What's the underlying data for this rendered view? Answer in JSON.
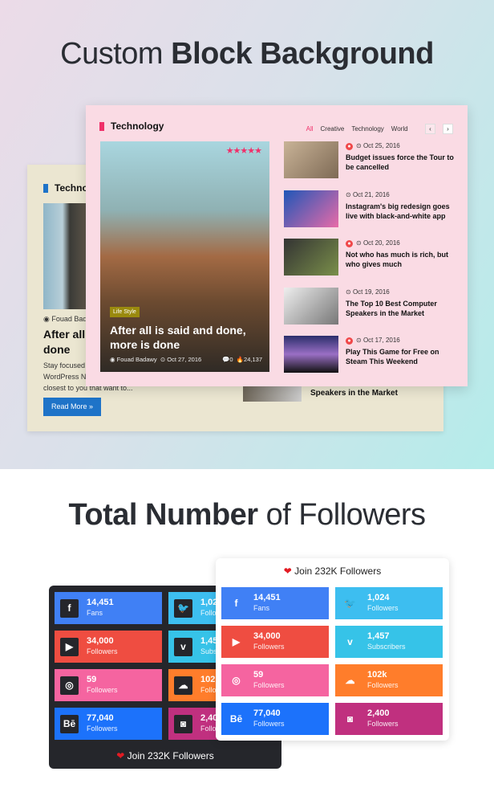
{
  "section1": {
    "title_light": "Custom ",
    "title_bold": "Block Background"
  },
  "back_card": {
    "heading": "Techno",
    "author": "Fouad Bada",
    "title_line1": "After all i",
    "title_line2": "done",
    "excerpt": [
      "Stay focused",
      "WordPress N",
      "closest to you that want to..."
    ],
    "read_more": "Read More »",
    "side_title": "Speakers in the Market",
    "accent": "#1e73c8"
  },
  "front_card": {
    "heading": "Technology",
    "accent": "#f0306a",
    "tabs": [
      "All",
      "Creative",
      "Technology",
      "World"
    ],
    "prev": "‹",
    "next": "›",
    "featured": {
      "category": "Life Style",
      "title": "After all is said and done, more is done",
      "author": "Fouad Badawy",
      "date": "Oct 27, 2016",
      "comments": "0",
      "views": "24,137",
      "rating": 5
    },
    "posts": [
      {
        "date": "Oct 25, 2016",
        "title": "Budget issues force the Tour to be cancelled",
        "hot": true
      },
      {
        "date": "Oct 21, 2016",
        "title": "Instagram's big redesign goes live with black-and-white app",
        "hot": false
      },
      {
        "date": "Oct 20, 2016",
        "title": "Not who has much is rich, but who gives much",
        "hot": true
      },
      {
        "date": "Oct 19, 2016",
        "title": "The Top 10 Best Computer Speakers in the Market",
        "hot": false
      },
      {
        "date": "Oct 17, 2016",
        "title": "Play This Game for Free on Steam This Weekend",
        "hot": true
      }
    ]
  },
  "section2": {
    "title_bold": "Total Number",
    "title_light": " of Followers"
  },
  "followers": {
    "join": "Join 232K Followers",
    "tiles": [
      {
        "icon": "facebook-icon",
        "glyph": "f",
        "count": "14,451",
        "label": "Fans",
        "color": "#4080f5"
      },
      {
        "icon": "twitter-icon",
        "glyph": "🐦",
        "count": "1,024",
        "label": "Followers",
        "color": "#3dbef0"
      },
      {
        "icon": "youtube-icon",
        "glyph": "▶",
        "count": "34,000",
        "label": "Followers",
        "color": "#ef4d41"
      },
      {
        "icon": "vimeo-icon",
        "glyph": "v",
        "count": "1,457",
        "label": "Subscribers",
        "color": "#36c3e8"
      },
      {
        "icon": "dribbble-icon",
        "glyph": "◎",
        "count": "59",
        "label": "Followers",
        "color": "#f564a0"
      },
      {
        "icon": "soundcloud-icon",
        "glyph": "☁",
        "count": "102k",
        "label": "Followers",
        "color": "#ff7d2b"
      },
      {
        "icon": "behance-icon",
        "glyph": "Bē",
        "count": "77,040",
        "label": "Followers",
        "color": "#1c72fb"
      },
      {
        "icon": "instagram-icon",
        "glyph": "◙",
        "count": "2,400",
        "label": "Followers",
        "color": "#c0307f"
      }
    ]
  }
}
